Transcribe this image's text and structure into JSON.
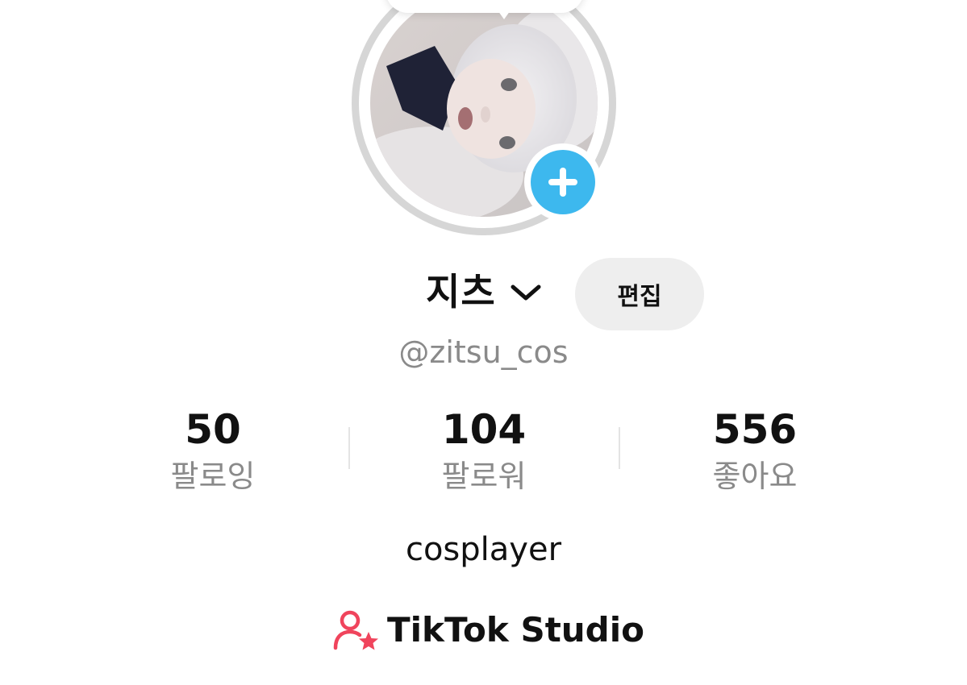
{
  "profile": {
    "display_name": "지츠",
    "username": "@zitsu_cos",
    "edit_label": "편집",
    "bio": "cosplayer"
  },
  "stats": [
    {
      "value": "50",
      "label": "팔로잉"
    },
    {
      "value": "104",
      "label": "팔로워"
    },
    {
      "value": "556",
      "label": "좋아요"
    }
  ],
  "studio": {
    "label": "TikTok Studio",
    "icon": "creator-star-icon"
  },
  "icons": {
    "add_photo": "plus-icon",
    "name_switch": "chevron-down-icon"
  },
  "colors": {
    "add_button": "#3db8ee",
    "studio_icon": "#f0445c",
    "secondary_text": "#8a8a8a",
    "edit_button_bg": "#eeeeee"
  }
}
